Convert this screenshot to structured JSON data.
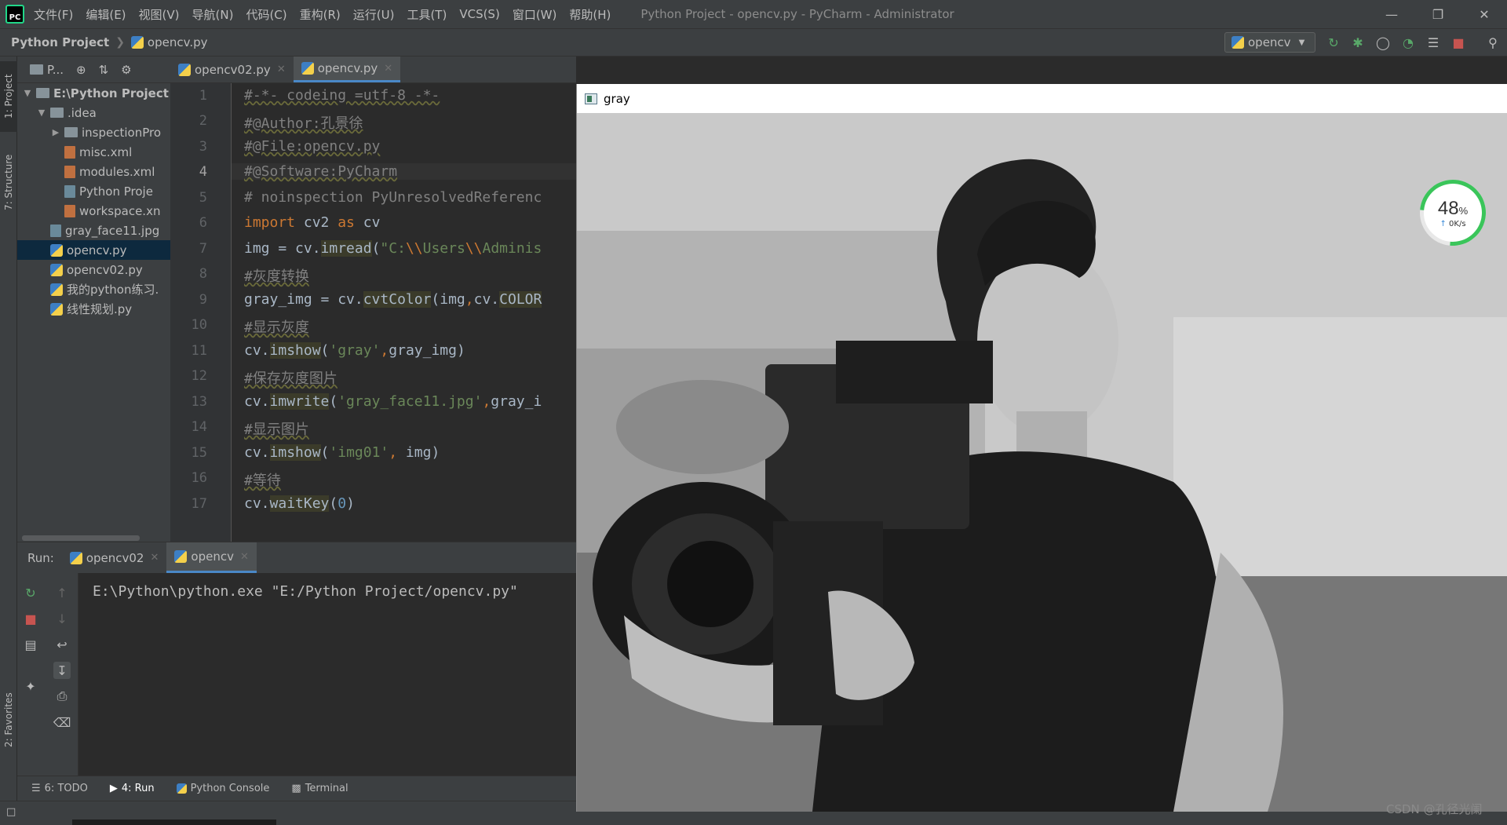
{
  "titlebar": {
    "menus": [
      "文件(F)",
      "编辑(E)",
      "视图(V)",
      "导航(N)",
      "代码(C)",
      "重构(R)",
      "运行(U)",
      "工具(T)",
      "VCS(S)",
      "窗口(W)",
      "帮助(H)"
    ],
    "window_title": "Python Project - opencv.py - PyCharm - Administrator"
  },
  "navbar": {
    "project": "Python Project",
    "file": "opencv.py",
    "run_config": "opencv"
  },
  "left_strip": {
    "project_tab": "1: Project",
    "structure_tab": "7: Structure",
    "favorites_tab": "2: Favorites"
  },
  "project_panel": {
    "view_label": "P...",
    "tree": [
      {
        "label": "E:\\Python Project",
        "type": "root"
      },
      {
        "label": ".idea",
        "type": "folder"
      },
      {
        "label": "inspectionPro",
        "type": "folder"
      },
      {
        "label": "misc.xml",
        "type": "xml"
      },
      {
        "label": "modules.xml",
        "type": "xml"
      },
      {
        "label": "Python Proje",
        "type": "file"
      },
      {
        "label": "workspace.xn",
        "type": "xml"
      },
      {
        "label": "gray_face11.jpg",
        "type": "image"
      },
      {
        "label": "opencv.py",
        "type": "py"
      },
      {
        "label": "opencv02.py",
        "type": "py"
      },
      {
        "label": "我的python练习.",
        "type": "py"
      },
      {
        "label": "线性规划.py",
        "type": "py"
      }
    ]
  },
  "editor": {
    "tabs": [
      {
        "label": "opencv02.py",
        "active": false
      },
      {
        "label": "opencv.py",
        "active": true
      }
    ],
    "line_numbers": [
      "1",
      "2",
      "3",
      "4",
      "5",
      "6",
      "7",
      "8",
      "9",
      "10",
      "11",
      "12",
      "13",
      "14",
      "15",
      "16",
      "17"
    ],
    "lines": [
      "#-*- codeing =utf-8 -*-",
      "#@Author:孔景徐",
      "#@File:opencv.py",
      "#@Software:PyCharm",
      "# noinspection PyUnresolvedReferenc",
      "import cv2 as cv",
      "img = cv.imread(\"C:\\\\Users\\\\Adminis",
      "#灰度转换",
      "gray_img = cv.cvtColor(img,cv.COLOR",
      "#显示灰度",
      "cv.imshow('gray',gray_img)",
      "#保存灰度图片",
      "cv.imwrite('gray_face11.jpg',gray_i",
      "#显示图片",
      "cv.imshow('img01', img)",
      "#等待",
      "cv.waitKey(0)"
    ]
  },
  "run_panel": {
    "label": "Run:",
    "tabs": [
      {
        "label": "opencv02",
        "active": false
      },
      {
        "label": "opencv",
        "active": true
      }
    ],
    "console_output": "E:\\Python\\python.exe \"E:/Python Project/opencv.py\""
  },
  "bottom_tabs": [
    "6: TODO",
    "4: Run",
    "Python Console",
    "Terminal"
  ],
  "image_window": {
    "title": "gray"
  },
  "net_widget": {
    "percent": "48",
    "unit": "%",
    "speed": "0K/s"
  },
  "watermark": "CSDN @孔径光阑"
}
